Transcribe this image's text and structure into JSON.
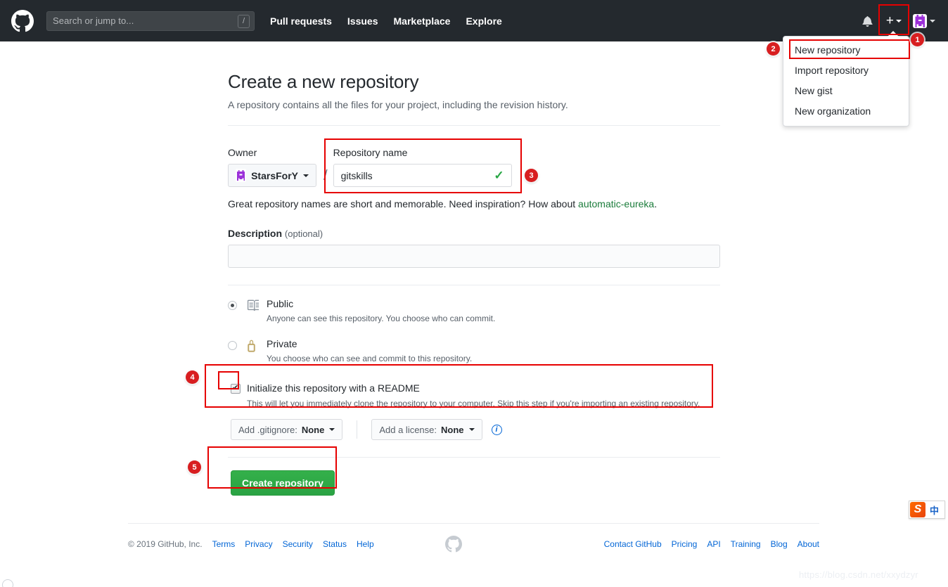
{
  "header": {
    "logo_icon": "github-mark-icon",
    "search": {
      "placeholder": "Search or jump to...",
      "shortcut_key": "/"
    },
    "nav": [
      {
        "label": "Pull requests"
      },
      {
        "label": "Issues"
      },
      {
        "label": "Marketplace"
      },
      {
        "label": "Explore"
      }
    ],
    "bell_icon": "notification-bell-icon",
    "plus_icon": "plus-icon",
    "avatar_icon": "user-identicon-avatar"
  },
  "dropdown": {
    "items": [
      {
        "label": "New repository",
        "highlighted": true
      },
      {
        "label": "Import repository",
        "highlighted": false
      },
      {
        "label": "New gist",
        "highlighted": false
      },
      {
        "label": "New organization",
        "highlighted": false
      }
    ]
  },
  "page": {
    "title": "Create a new repository",
    "subtitle": "A repository contains all the files for your project, including the revision history."
  },
  "form": {
    "owner_label": "Owner",
    "owner_value": "StarsForY",
    "separator": "/",
    "repo_name_label": "Repository name",
    "repo_name_value": "gitskills",
    "repo_name_valid_icon": "green-check-icon",
    "hint_prefix": "Great repository names are short and memorable. Need inspiration? How about ",
    "hint_suggestion": "automatic-eureka",
    "hint_suffix": ".",
    "description_label": "Description",
    "description_optional": "(optional)",
    "description_value": "",
    "visibility": [
      {
        "id": "public",
        "icon": "repo-book-icon",
        "title": "Public",
        "description": "Anyone can see this repository. You choose who can commit.",
        "selected": true
      },
      {
        "id": "private",
        "icon": "lock-icon",
        "title": "Private",
        "description": "You choose who can see and commit to this repository.",
        "selected": false
      }
    ],
    "readme": {
      "checked": true,
      "title": "Initialize this repository with a README",
      "description": "This will let you immediately clone the repository to your computer. Skip this step if you're importing an existing repository."
    },
    "gitignore_prefix": "Add .gitignore:",
    "gitignore_value": "None",
    "license_prefix": "Add a license:",
    "license_value": "None",
    "info_icon": "info-circle-icon",
    "submit_label": "Create repository"
  },
  "footer": {
    "copyright": "© 2019 GitHub, Inc.",
    "left_links": [
      {
        "label": "Terms"
      },
      {
        "label": "Privacy"
      },
      {
        "label": "Security"
      },
      {
        "label": "Status"
      },
      {
        "label": "Help"
      }
    ],
    "logo_icon": "github-mark-footer-icon",
    "right_links": [
      {
        "label": "Contact GitHub"
      },
      {
        "label": "Pricing"
      },
      {
        "label": "API"
      },
      {
        "label": "Training"
      },
      {
        "label": "Blog"
      },
      {
        "label": "About"
      }
    ]
  },
  "annotations": {
    "badges": [
      {
        "number": "1"
      },
      {
        "number": "2"
      },
      {
        "number": "3"
      },
      {
        "number": "4"
      },
      {
        "number": "5"
      }
    ],
    "highlight_color": "#e60000",
    "badge_color": "#d81e20"
  },
  "ime": {
    "logo_letter": "S",
    "mode_label": "中"
  },
  "watermark": {
    "text": "https://blog.csdn.net/xxydzyr"
  }
}
